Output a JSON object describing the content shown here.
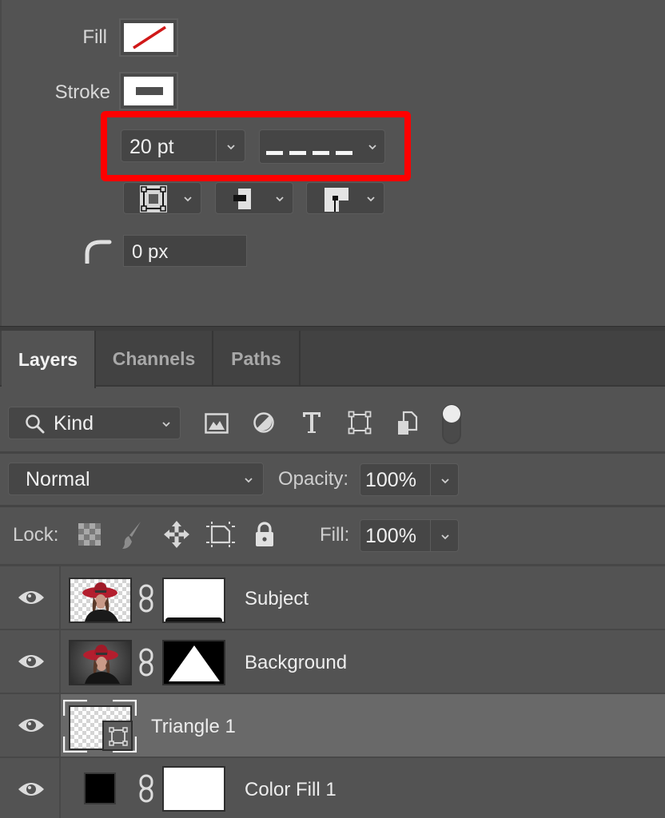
{
  "properties": {
    "fill_label": "Fill",
    "stroke_label": "Stroke",
    "fill_swatch": "none (red slash)",
    "stroke_swatch": "solid dark gray",
    "stroke_width": "20 pt",
    "stroke_type": "dashed",
    "stroke_align_icon": "stroke-align-inside-icon",
    "stroke_caps_icon": "stroke-cap-icon",
    "stroke_corners_icon": "stroke-corner-icon",
    "corner_radius": "0 px",
    "highlight_color": "#ff0000"
  },
  "tabs": [
    {
      "label": "Layers",
      "active": true
    },
    {
      "label": "Channels",
      "active": false
    },
    {
      "label": "Paths",
      "active": false
    }
  ],
  "filter": {
    "kind_label": "Kind",
    "icons": [
      "image-filter-icon",
      "adjustment-filter-icon",
      "type-filter-icon",
      "shape-filter-icon",
      "smart-object-filter-icon"
    ],
    "toggle": "filter-toggle"
  },
  "blend": {
    "mode": "Normal",
    "opacity_label": "Opacity:",
    "opacity_value": "100%"
  },
  "lock": {
    "label": "Lock:",
    "fill_label": "Fill:",
    "fill_value": "100%"
  },
  "layers": [
    {
      "name": "Subject",
      "visible": true,
      "selected": false,
      "has_mask": true
    },
    {
      "name": "Background",
      "visible": true,
      "selected": false,
      "has_mask": true
    },
    {
      "name": "Triangle 1",
      "visible": true,
      "selected": true,
      "has_mask": false
    },
    {
      "name": "Color Fill 1",
      "visible": true,
      "selected": false,
      "has_mask": true
    }
  ]
}
